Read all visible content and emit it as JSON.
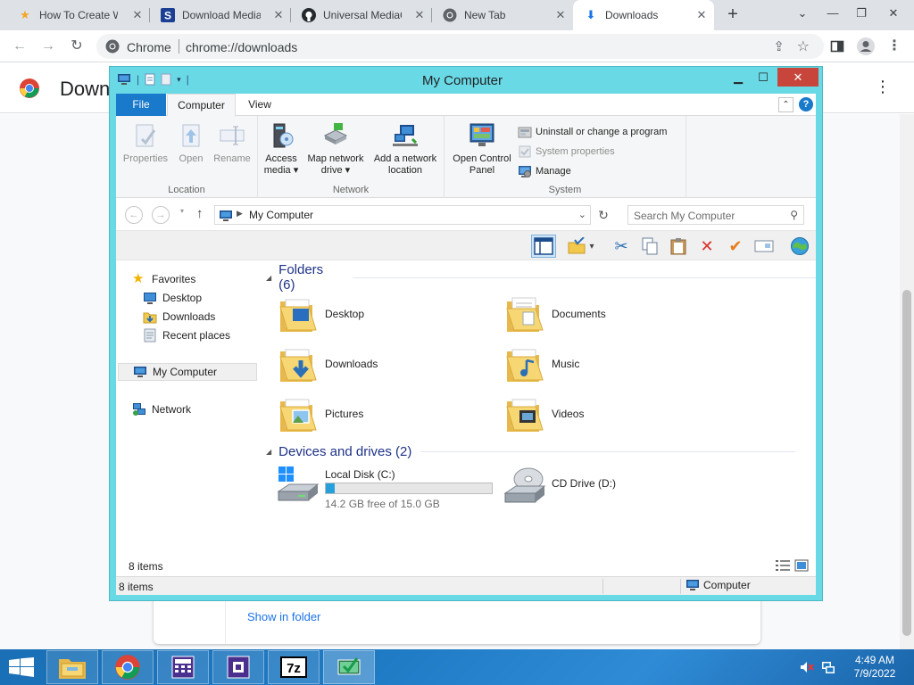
{
  "browser": {
    "tabs": [
      {
        "title": "How To Create W",
        "icon": "star-icon",
        "active": false
      },
      {
        "title": "Download Media",
        "icon": "s-logo-icon",
        "active": false
      },
      {
        "title": "Universal MediaC",
        "icon": "github-icon",
        "active": false
      },
      {
        "title": "New Tab",
        "icon": "chrome-icon",
        "active": false
      },
      {
        "title": "Downloads",
        "icon": "download-icon",
        "active": true
      }
    ],
    "site_name": "Chrome",
    "url": "chrome://downloads"
  },
  "downloads_page": {
    "title": "Downloads",
    "show_in_folder": "Show in folder"
  },
  "explorer": {
    "window_title": "My Computer",
    "ribbon_tabs": {
      "file": "File",
      "computer": "Computer",
      "view": "View"
    },
    "ribbon": {
      "location_group": "Location",
      "network_group": "Network",
      "system_group": "System",
      "properties": "Properties",
      "open": "Open",
      "rename": "Rename",
      "access_media_1": "Access",
      "access_media_2": "media ▾",
      "map_network_1": "Map network",
      "map_network_2": "drive ▾",
      "add_network_1": "Add a network",
      "add_network_2": "location",
      "open_cp_1": "Open Control",
      "open_cp_2": "Panel",
      "uninstall": "Uninstall or change a program",
      "system_properties": "System properties",
      "manage": "Manage"
    },
    "address": "My Computer",
    "search_placeholder": "Search My Computer",
    "nav": {
      "favorites": "Favorites",
      "desktop": "Desktop",
      "downloads": "Downloads",
      "recent_places": "Recent places",
      "my_computer": "My Computer",
      "network": "Network"
    },
    "folders_header": "Folders (6)",
    "folders": [
      "Desktop",
      "Documents",
      "Downloads",
      "Music",
      "Pictures",
      "Videos"
    ],
    "devices_header": "Devices and drives (2)",
    "drives": {
      "c_name": "Local Disk (C:)",
      "c_free": "14.2 GB free of 15.0 GB",
      "c_used_fraction": 0.053,
      "d_name": "CD Drive (D:)"
    },
    "details_count": "8 items",
    "status_count": "8 items",
    "status_location": "Computer"
  },
  "taskbar": {
    "time": "4:49 AM",
    "date": "7/9/2022"
  },
  "colors": {
    "window_frame": "#6ad9e6",
    "accent": "#1979ca",
    "close_button": "#c7453a",
    "taskbar": "#1f7ac4",
    "progress": "#26a0da"
  }
}
